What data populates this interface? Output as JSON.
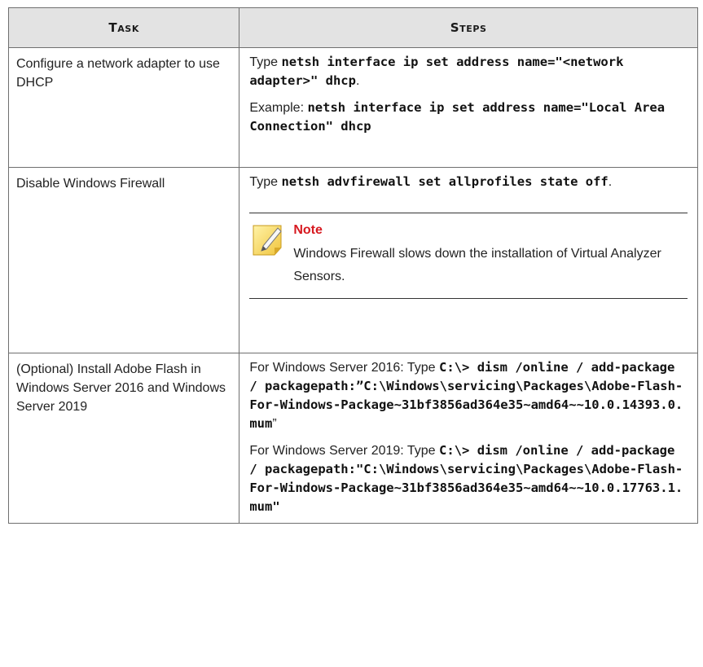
{
  "header": {
    "task": "Task",
    "steps": "Steps"
  },
  "rows": [
    {
      "task": "Configure a network adapter to use DHCP",
      "s1_pre": "Type ",
      "s1_code": "netsh interface ip set address name=\"<network adapter>\" dhcp",
      "s1_post": ".",
      "s2_pre": "Example: ",
      "s2_code": "netsh interface ip set address name=\"Local Area Connection\" dhcp"
    },
    {
      "task": "Disable Windows Firewall",
      "s1_pre": "Type ",
      "s1_code": "netsh advfirewall set allprofiles state off",
      "s1_post": ".",
      "note_title": "Note",
      "note_text": "Windows Firewall slows down the installation of Virtual Analyzer Sensors.",
      "note_icon": "note-pencil-icon"
    },
    {
      "task": "(Optional) Install Adobe Flash in Windows Server 2016 and Windows Server 2019",
      "s1_pre": "For Windows Server 2016: Type ",
      "s1_code": "C:\\> dism /online / add-package / packagepath:”C:\\Windows\\servicing\\Packages\\Adobe-Flash-For-Windows-Package~31bf3856ad364e35~amd64~~10.0.14393.0.mum",
      "s1_post": "”",
      "s2_pre": "For Windows Server 2019: Type ",
      "s2_code": "C:\\> dism /online / add-package / packagepath:\"C:\\Windows\\servicing\\Packages\\Adobe-Flash-For-Windows-Package~31bf3856ad364e35~amd64~~10.0.17763.1.mum\""
    }
  ]
}
